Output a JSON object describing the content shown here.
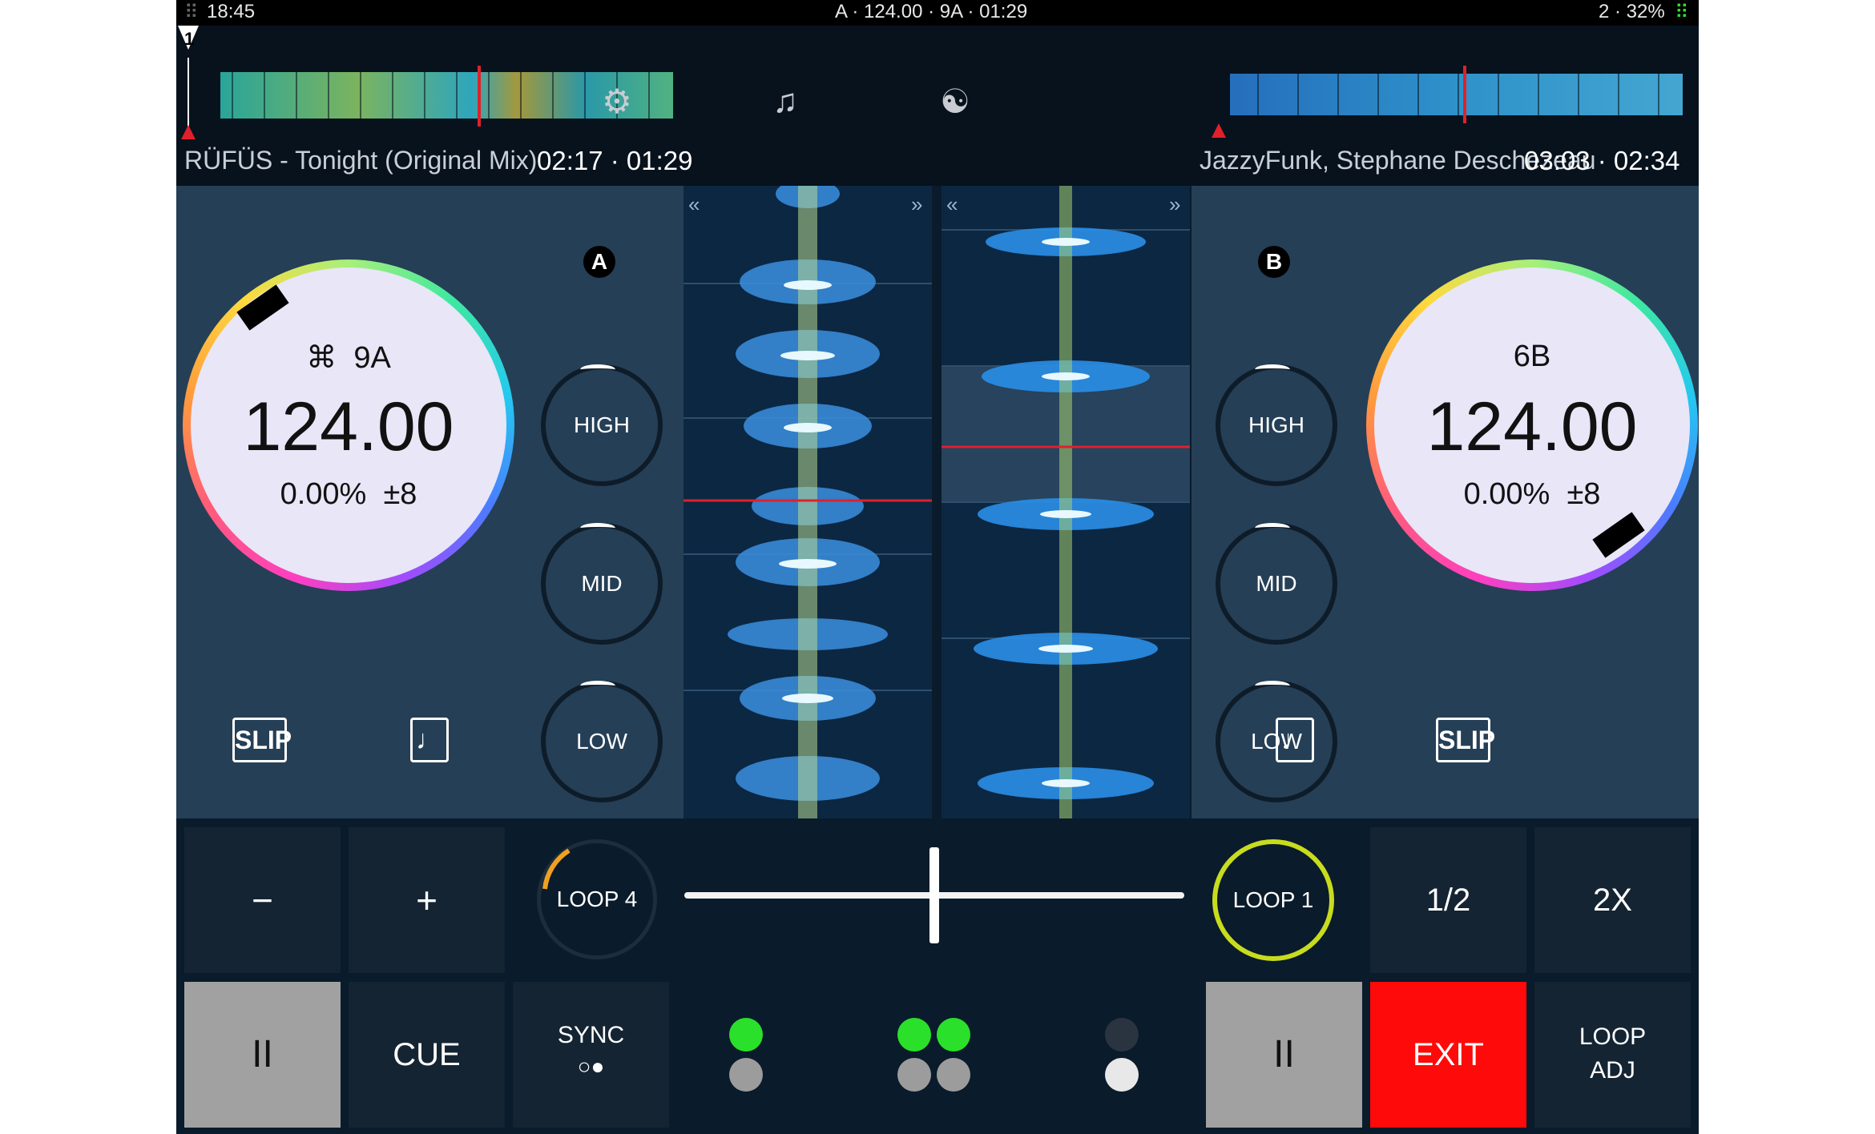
{
  "status_bar": {
    "time": "18:45",
    "center": "A · 124.00 · 9A · 01:29",
    "battery": "2 · 32%"
  },
  "header": {
    "cue_marker": "1",
    "settings_icon": "gear-icon",
    "library_icon": "music-note-icon",
    "mixer_icon": "yin-yang-icon",
    "deck_a": {
      "title": "RÜFÜS - Tonight (Original Mix)",
      "times": "02:17 · 01:29"
    },
    "deck_b": {
      "title": "JazzyFunk, Stephane Deschezeau",
      "times": "03:03 · 02:34"
    }
  },
  "deck_a": {
    "letter": "A",
    "key_symbol": "⌘",
    "key": "9A",
    "bpm": "124.00",
    "pitch": "0.00%",
    "range": "±8",
    "eq": [
      "HIGH",
      "MID",
      "LOW"
    ],
    "slip": "SLIP",
    "quantize_icon": "note-icon"
  },
  "deck_b": {
    "letter": "B",
    "key": "6B",
    "bpm": "124.00",
    "pitch": "0.00%",
    "range": "±8",
    "eq": [
      "HIGH",
      "MID",
      "LOW"
    ],
    "slip": "SLIP",
    "quantize_icon": "note-icon"
  },
  "waveform": {
    "prev": "«",
    "next": "»"
  },
  "controls": {
    "minus": "−",
    "plus": "+",
    "loop_a": "LOOP 4",
    "loop_b": "LOOP 1",
    "half": "1/2",
    "double": "2X",
    "play_a": "II",
    "cue": "CUE",
    "sync": "SYNC",
    "play_b": "II",
    "exit": "EXIT",
    "loop_adj_1": "LOOP",
    "loop_adj_2": "ADJ"
  },
  "colors": {
    "background": "#0a1b2b",
    "deck_panel": "#253f56",
    "exit_red": "#ff0a0a",
    "led_green": "#2ae02a",
    "loop_b_ring": "#c8dc1e",
    "loop_a_arc": "#f0a020",
    "playhead_red": "#e0202a"
  }
}
